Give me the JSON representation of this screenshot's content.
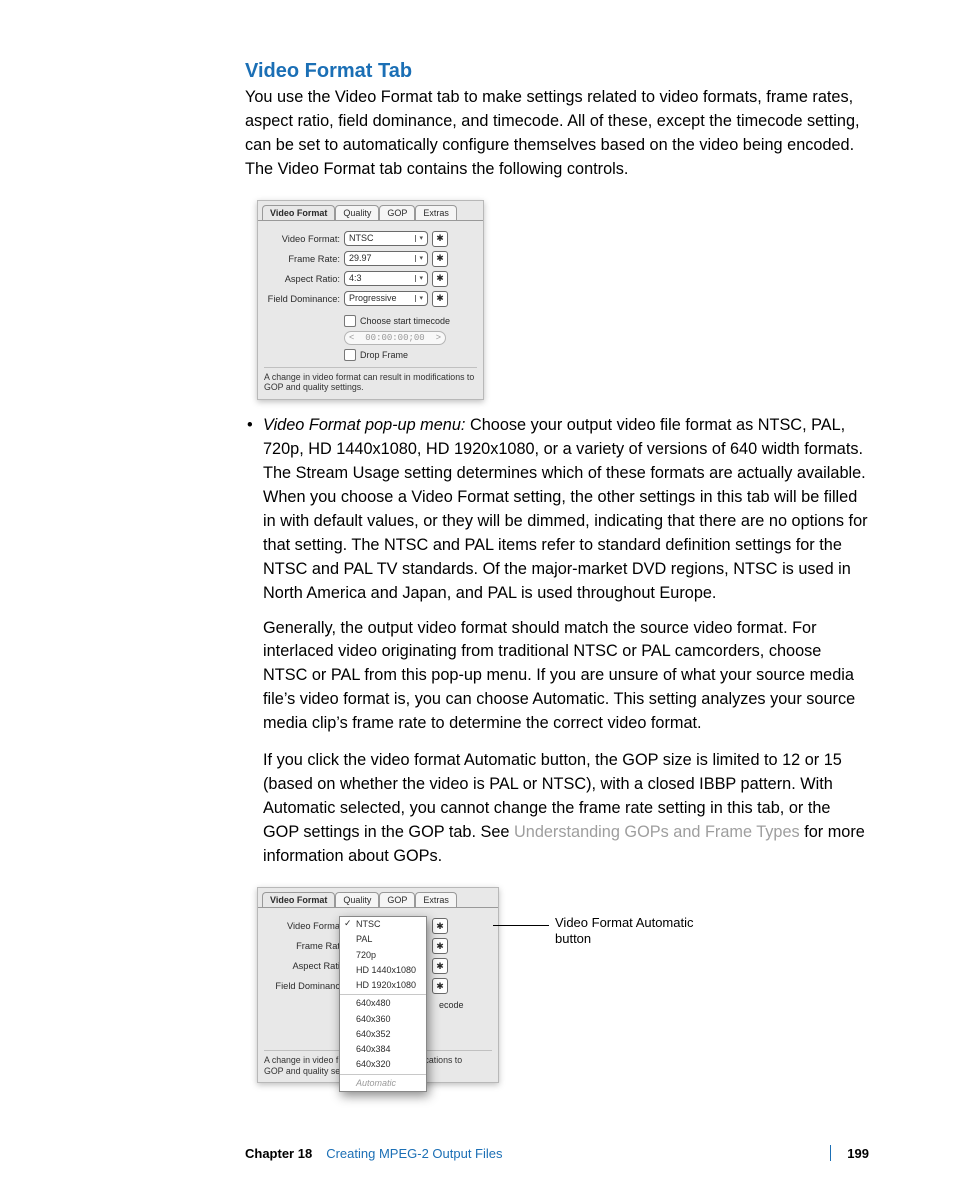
{
  "heading": "Video Format Tab",
  "intro": "You use the Video Format tab to make settings related to video formats, frame rates, aspect ratio, field dominance, and timecode. All of these, except the timecode setting, can be set to automatically configure themselves based on the video being encoded. The Video Format tab contains the following controls.",
  "bulletTerm": "Video Format pop-up menu:  ",
  "bulletBody": "Choose your output video file format as NTSC, PAL, 720p, HD 1440x1080, HD 1920x1080, or a variety of versions of 640 width formats. The Stream Usage setting determines which of these formats are actually available. When you choose a Video Format setting, the other settings in this tab will be filled in with default values, or they will be dimmed, indicating that there are no options for that setting. The NTSC and PAL items refer to standard definition settings for the NTSC and PAL TV standards. Of the major-market DVD regions, NTSC is used in North America and Japan, and PAL is used throughout Europe.",
  "para2": "Generally, the output video format should match the source video format. For interlaced video originating from traditional NTSC or PAL camcorders, choose NTSC or PAL from this pop-up menu. If you are unsure of what your source media file’s video format is, you can choose Automatic. This setting analyzes your source media clip’s frame rate to determine the correct video format.",
  "para3a": "If you click the video format Automatic button, the GOP size is limited to 12 or 15 (based on whether the video is PAL or NTSC), with a closed IBBP pattern. With Automatic selected, you cannot change the frame rate setting in this tab, or the GOP settings in the GOP tab. See ",
  "para3link": "Understanding GOPs and Frame Types",
  "para3b": " for more information about GOPs.",
  "tabs": {
    "t1": "Video Format",
    "t2": "Quality",
    "t3": "GOP",
    "t4": "Extras"
  },
  "labels": {
    "videoFormat": "Video Format:",
    "frameRate": "Frame Rate:",
    "aspectRatio": "Aspect Ratio:",
    "fieldDominance": "Field Dominance:"
  },
  "values": {
    "videoFormat": "NTSC",
    "frameRate": "29.97",
    "aspectRatio": "4:3",
    "fieldDominance": "Progressive"
  },
  "checkboxes": {
    "startTimecode": "Choose start timecode",
    "timecode": "00:00:00;00",
    "dropFrame": "Drop Frame"
  },
  "panelNote": "A change in video format can result in modifications to GOP and quality settings.",
  "labels2": {
    "videoFormat": "Video Forma",
    "frameRate": "Frame Rat",
    "aspectRatio": "Aspect Rati",
    "fieldDominance": "Field Dominanc"
  },
  "panelNote2a": "A change in video f",
  "panelNote2b": "GOP and quality se",
  "panelNote2c": "difications to",
  "recodeFrag": "ecode",
  "popupItems": {
    "ntsc": "NTSC",
    "pal": "PAL",
    "p720": "720p",
    "hd1440": "HD 1440x1080",
    "hd1920": "HD 1920x1080",
    "r480": "640x480",
    "r360": "640x360",
    "r352": "640x352",
    "r384": "640x384",
    "r320": "640x320",
    "auto": "Automatic"
  },
  "callout": "Video Format Automatic button",
  "footer": {
    "chapterLabel": "Chapter 18",
    "chapterTitle": "Creating MPEG-2 Output Files",
    "pageNo": "199"
  }
}
